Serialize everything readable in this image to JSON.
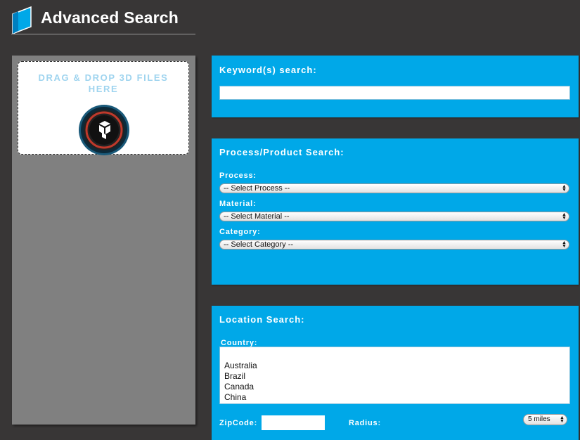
{
  "header": {
    "title": "Advanced Search",
    "logo_icon": "blue-cube-logo"
  },
  "dropzone": {
    "text": "DRAG & DROP 3D FILES HERE",
    "icon": "3d-upload-badge-icon"
  },
  "keyword_panel": {
    "title": "Keyword(s) search:",
    "input_value": ""
  },
  "process_panel": {
    "title": "Process/Product Search:",
    "process_label": "Process:",
    "process_selected": "-- Select Process --",
    "material_label": "Material:",
    "material_selected": "-- Select Material --",
    "category_label": "Category:",
    "category_selected": "-- Select Category --"
  },
  "location_panel": {
    "title": "Location Search:",
    "country_label": "Country:",
    "countries": [
      "",
      "Australia",
      "Brazil",
      "Canada",
      "China"
    ],
    "zipcode_label": "ZipCode:",
    "zipcode_value": "",
    "radius_label": "Radius:",
    "radius_selected": "5 miles"
  },
  "colors": {
    "background": "#383636",
    "panel_blue": "#00a8e8",
    "left_panel": "#808080",
    "dropzone_text": "#9fd4ef"
  }
}
